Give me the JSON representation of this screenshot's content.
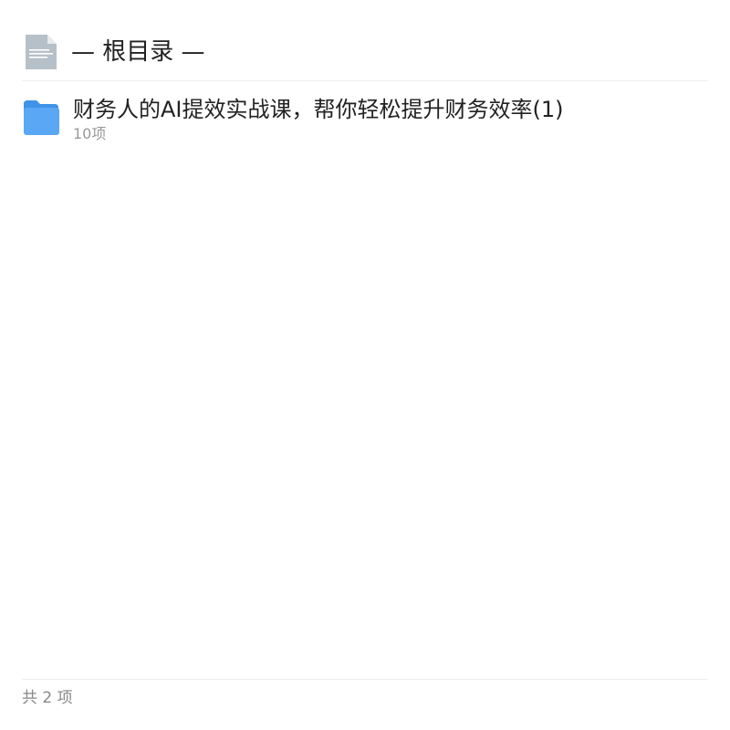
{
  "header": {
    "icon": "document-icon",
    "title": "— 根目录 —"
  },
  "items": [
    {
      "icon": "folder-icon",
      "name": "财务人的AI提效实战课，帮你轻松提升财务效率(1)",
      "meta": "10项"
    }
  ],
  "footer": {
    "count_text": "共 2 项"
  },
  "colors": {
    "folder": "#5aa7f5",
    "folder_tab": "#3f93e8",
    "document": "#b6c0c8",
    "divider": "#eeeeee",
    "meta_text": "#999999"
  }
}
